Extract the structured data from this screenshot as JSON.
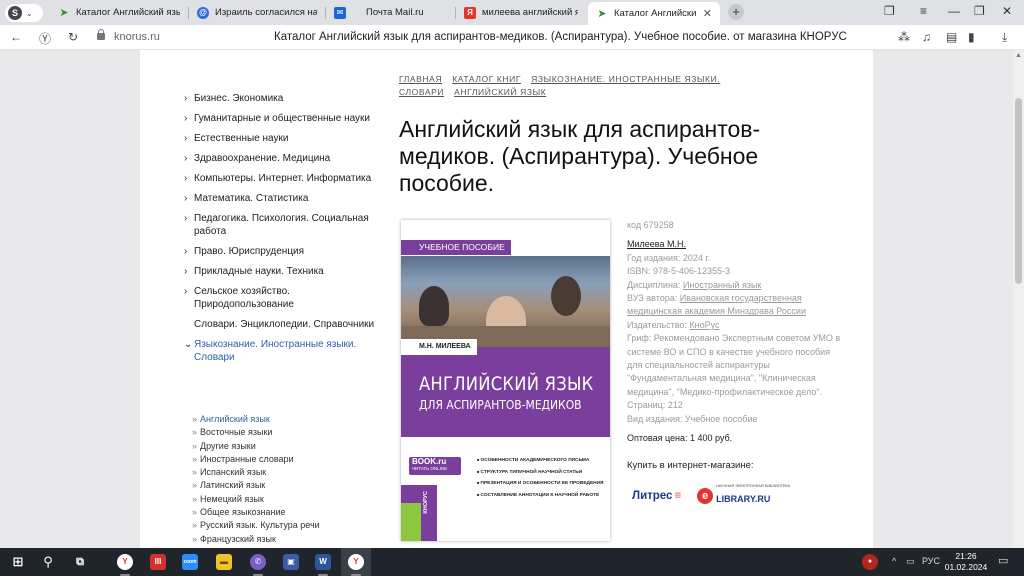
{
  "browser": {
    "tabs": [
      {
        "label": "Каталог Английский язык",
        "favicon": "knorus-icon",
        "color": "#3b8f3b"
      },
      {
        "label": "Израиль согласился на пр",
        "favicon": "news-icon",
        "color": "#2b6be0"
      },
      {
        "label": "Почта Mail.ru",
        "favicon": "mail-icon",
        "color": "#1e66d8"
      },
      {
        "label": "милеева английский язык",
        "favicon": "yandex-icon",
        "color": "#e3342f"
      },
      {
        "label": "Каталог Английский язык",
        "favicon": "knorus-icon",
        "color": "#3b8f3b",
        "active": true
      }
    ],
    "address": {
      "domain": "knorus.ru",
      "page_title": "Каталог Английский язык для аспирантов-медиков. (Аспирантура). Учебное пособие. от магазина КНОРУС"
    }
  },
  "sidebar": {
    "categories": [
      {
        "label": "Бизнес. Экономика",
        "arrow": "›"
      },
      {
        "label": "Гуманитарные и общественные науки",
        "arrow": "›"
      },
      {
        "label": "Естественные науки",
        "arrow": "›"
      },
      {
        "label": "Здравоохранение. Медицина",
        "arrow": "›"
      },
      {
        "label": "Компьютеры. Интернет. Информатика",
        "arrow": "›"
      },
      {
        "label": "Математика. Статистика",
        "arrow": "›"
      },
      {
        "label": "Педагогика. Психология. Социальная работа",
        "arrow": "›"
      },
      {
        "label": "Право. Юриспруденция",
        "arrow": "›"
      },
      {
        "label": "Прикладные науки. Техника",
        "arrow": "›"
      },
      {
        "label": "Сельское хозяйство. Природопользование",
        "arrow": "›"
      },
      {
        "label": "Словари. Энциклопедии. Справочники",
        "arrow": ""
      },
      {
        "label": "Языкознание. Иностранные языки. Словари",
        "arrow": "⌄",
        "open": true
      }
    ],
    "subcategories": [
      {
        "label": "Английский язык",
        "active": true
      },
      {
        "label": "Восточные языки"
      },
      {
        "label": "Другие языки"
      },
      {
        "label": "Иностранные словари"
      },
      {
        "label": "Испанский язык"
      },
      {
        "label": "Латинский язык"
      },
      {
        "label": "Немецкий язык"
      },
      {
        "label": "Общее языкознание"
      },
      {
        "label": "Русский язык. Культура речи"
      },
      {
        "label": "Французский язык"
      }
    ]
  },
  "breadcrumbs": [
    "Главная",
    "Каталог книг",
    "Языкознание. Иностранные языки. Словари",
    "Английский язык"
  ],
  "product": {
    "title": "Английский язык для аспирантов-медиков. (Аспирантура). Учебное пособие.",
    "cover": {
      "series_label": "УЧЕБНОЕ ПОСОБИЕ",
      "author": "М.Н. МИЛЕЕВА",
      "title_line1": "АНГЛИЙСКИЙ ЯЗЫК",
      "title_line2": "ДЛЯ АСПИРАНТОВ-МЕДИКОВ",
      "bookru": "BOOK.ru",
      "bookru_sub": "ЧИТАТЬ ONLINE",
      "bullets": [
        "ОСОБЕННОСТИ АКАДЕМИЧЕСКОГО ПИСЬМА",
        "СТРУКТУРА ТИПИЧНОЙ НАУЧНОЙ СТАТЬИ",
        "ПРЕЗЕНТАЦИЯ И ОСОБЕННОСТИ ЕЕ ПРОВЕДЕНИЯ",
        "СОСТАВЛЕНИЕ АННОТАЦИИ К НАУЧНОЙ РАБОТЕ"
      ],
      "publisher_mark": "КНОРУС"
    },
    "code": "код 679258",
    "author": "Милеева М.Н.",
    "year": "Год издания: 2024 г.",
    "isbn": "ISBN: 978-5-406-12355-3",
    "discipline_label": "Дисциплина: ",
    "discipline_value": "Иностранный язык",
    "university_label": "ВУЗ автора: ",
    "university_value": "Ивановская государственная медицинская академия Минздрава России",
    "publisher_label": "Издательство: ",
    "publisher_value": "КноРус",
    "grif": "Гриф: Рекомендовано Экспертным советом УМО в системе ВО и СПО в качестве учебного пособия для специальностей аспирантуры \"Фундаментальная медицина\", \"Клиническая медицина\", \"Медико-профилактическое дело\".",
    "pages": "Страниц: 212",
    "edition_type": "Вид издания: Учебное пособие",
    "price": "Оптовая цена: 1 400 руб.",
    "buy_label": "Купить в интернет-магазине:",
    "stores": {
      "litres": "Литрес",
      "elibrary_top": "НАУЧНАЯ ЭЛЕКТРОННАЯ БИБЛИОТЕКА",
      "elibrary": "LIBRARY.RU"
    }
  },
  "taskbar": {
    "lang": "РУС",
    "time": "21:26",
    "date": "01.02.2024"
  }
}
